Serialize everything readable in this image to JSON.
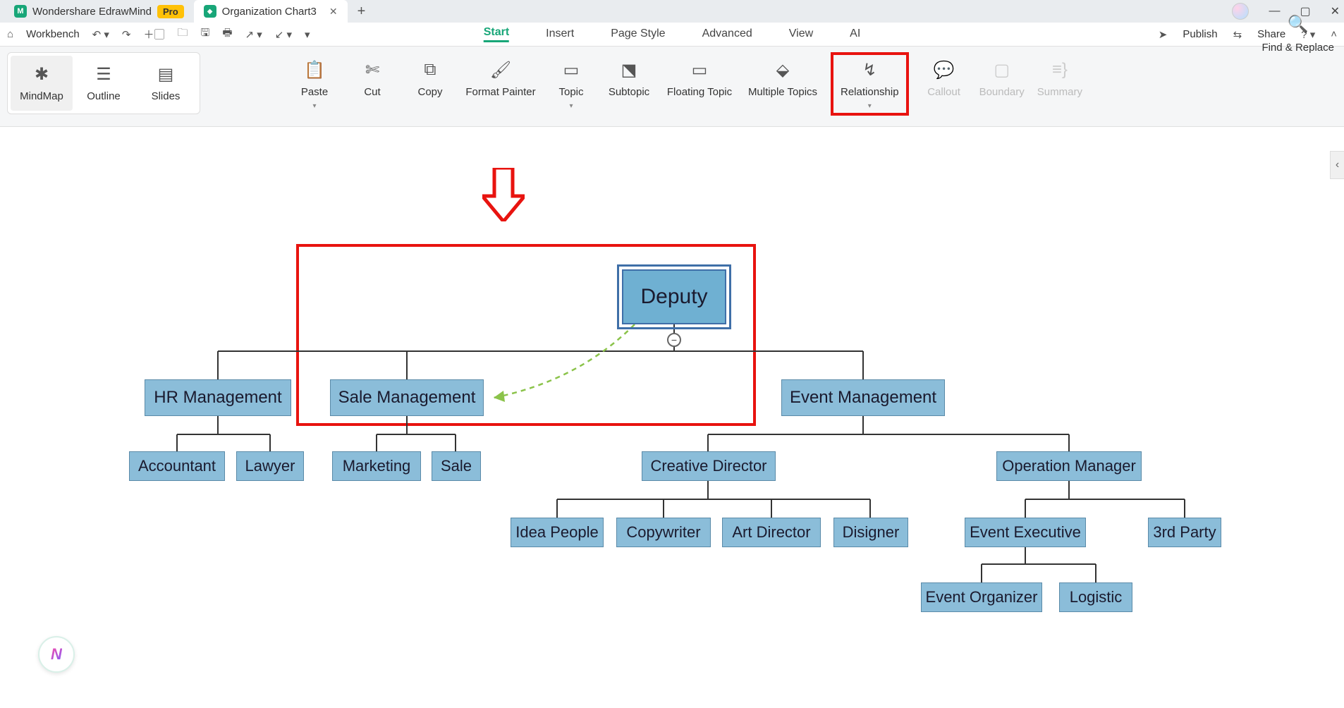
{
  "tabs": {
    "app_name": "Wondershare EdrawMind",
    "pro_badge": "Pro",
    "doc_name": "Organization Chart3"
  },
  "quickbar": {
    "workbench": "Workbench"
  },
  "menu": {
    "start": "Start",
    "insert": "Insert",
    "page_style": "Page Style",
    "advanced": "Advanced",
    "view": "View",
    "ai": "AI"
  },
  "top_right": {
    "publish": "Publish",
    "share": "Share"
  },
  "views": {
    "mindmap": "MindMap",
    "outline": "Outline",
    "slides": "Slides"
  },
  "ribbon": {
    "paste": "Paste",
    "cut": "Cut",
    "copy": "Copy",
    "format_painter": "Format Painter",
    "topic": "Topic",
    "subtopic": "Subtopic",
    "floating_topic": "Floating Topic",
    "multiple_topics": "Multiple Topics",
    "relationship": "Relationship",
    "callout": "Callout",
    "boundary": "Boundary",
    "summary": "Summary",
    "find_replace": "Find & Replace"
  },
  "chart_data": {
    "type": "org-chart",
    "root": "Deputy",
    "level1": [
      "HR Management",
      "Sale Management",
      "Event Management"
    ],
    "hr_children": [
      "Accountant",
      "Lawyer"
    ],
    "sale_children": [
      "Marketing",
      "Sale"
    ],
    "event_children": [
      "Creative Director",
      "Operation Manager"
    ],
    "creative_children": [
      "Idea People",
      "Copywriter",
      "Art Director",
      "Disigner"
    ],
    "operation_children": [
      "Event Executive",
      "3rd Party"
    ],
    "executive_children": [
      "Event Organizer",
      "Logistic"
    ],
    "relationship_arrow": {
      "from": "Deputy",
      "to": "Sale Management",
      "style": "dashed-green"
    }
  }
}
